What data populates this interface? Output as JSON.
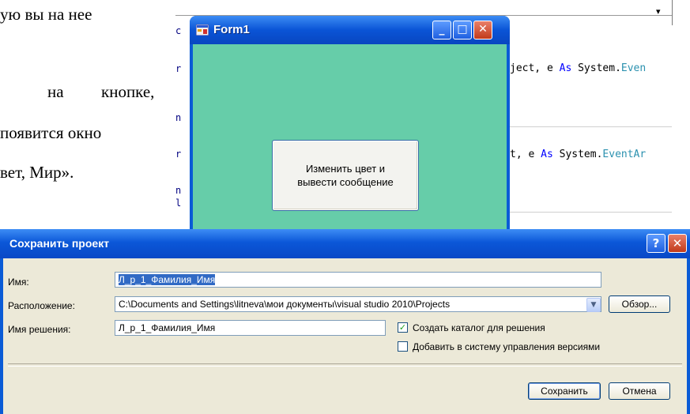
{
  "document": {
    "lines": [
      "ую вы на нее",
      "на",
      "кнопке,",
      "появится окно",
      "вет, Мир»."
    ]
  },
  "code_editor": {
    "lines": [
      {
        "margin": "c"
      },
      {
        "margin": "r",
        "pre": "ject, e ",
        "kw": "As",
        "post": " System.",
        "typ": "Even"
      },
      {
        "margin": "n"
      },
      {
        "margin": "r",
        "pre": "t, e ",
        "kw": "As",
        "post": " System.",
        "typ": "EventAr"
      },
      {
        "margin": "n"
      },
      {
        "margin": "l"
      }
    ],
    "combo_arrow": "▾"
  },
  "form1": {
    "title": "Form1",
    "minimize": "_",
    "maximize": "□",
    "close": "✕",
    "button_label": "Изменить цвет и\nвывести сообщение",
    "colors": {
      "client": "#66cda9",
      "titlebar": "#0a54d6"
    }
  },
  "save_dialog": {
    "title": "Сохранить проект",
    "help": "?",
    "close": "✕",
    "name_label": "Имя:",
    "name_value": "Л_р_1_Фамилия_Имя",
    "location_label": "Расположение:",
    "location_value": "C:\\Documents and Settings\\litneva\\мои документы\\visual studio 2010\\Projects",
    "browse_button": "Обзор...",
    "solution_label": "Имя решения:",
    "solution_value": "Л_р_1_Фамилия_Имя",
    "create_dir_label": "Создать каталог для решения",
    "create_dir_checked": true,
    "add_vcs_label": "Добавить в систему управления версиями",
    "add_vcs_checked": false,
    "save_button": "Сохранить",
    "cancel_button": "Отмена"
  }
}
